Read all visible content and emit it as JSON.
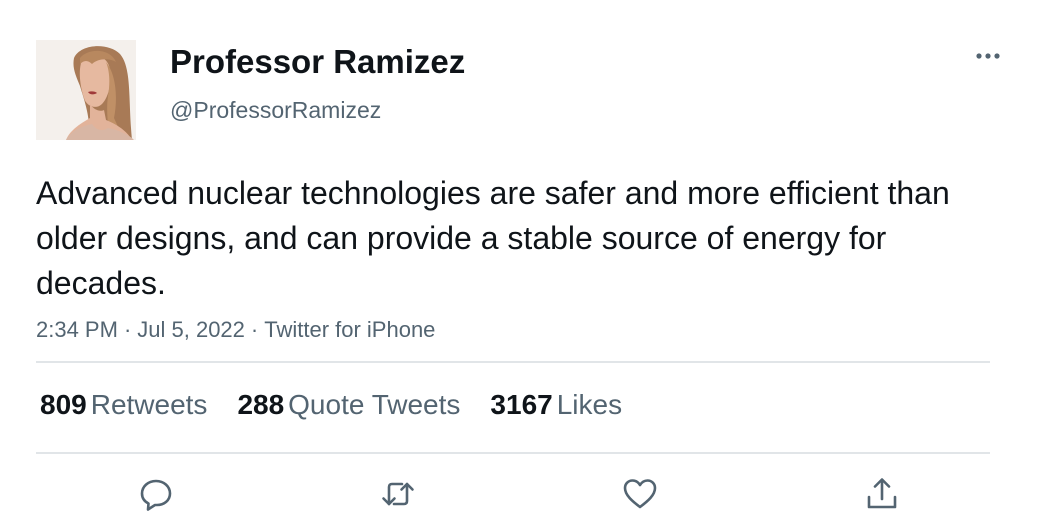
{
  "author": {
    "display_name": "Professor Ramizez",
    "handle": "@ProfessorRamizez"
  },
  "tweet": {
    "text": "Advanced nuclear technologies are safer and more efficient than older designs, and can provide a stable source of energy for decades.",
    "time": "2:34 PM",
    "date": "Jul 5, 2022",
    "source": "Twitter for iPhone",
    "separator": "·"
  },
  "stats": {
    "retweets": {
      "count": "809",
      "label": "Retweets"
    },
    "quote_tweets": {
      "count": "288",
      "label": "Quote Tweets"
    },
    "likes": {
      "count": "3167",
      "label": "Likes"
    }
  },
  "icons": {
    "more": "more-horizontal-icon",
    "reply": "reply-icon",
    "retweet": "retweet-icon",
    "like": "heart-icon",
    "share": "share-icon"
  },
  "colors": {
    "text_primary": "#0f1419",
    "text_secondary": "#536471",
    "divider": "#e1e5e8",
    "background": "#ffffff"
  }
}
